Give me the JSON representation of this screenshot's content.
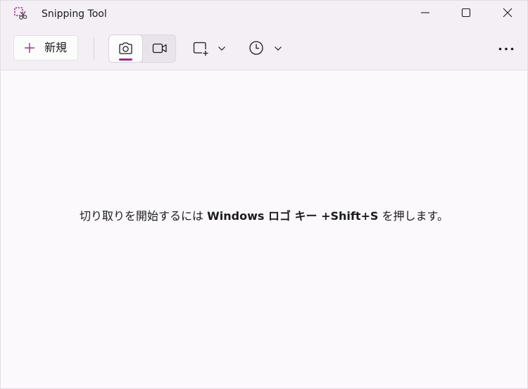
{
  "window": {
    "title": "Snipping Tool",
    "controls": {
      "minimize_icon": "minimize-icon",
      "maximize_icon": "maximize-icon",
      "close_icon": "close-icon"
    }
  },
  "toolbar": {
    "new_label": "新規",
    "new_icon": "plus-icon",
    "modes": [
      {
        "name": "snip-mode",
        "icon": "camera-icon",
        "selected": true
      },
      {
        "name": "record-mode",
        "icon": "video-camera-icon",
        "selected": false
      }
    ],
    "shape_icon": "rectangle-snip-icon",
    "delay_icon": "clock-icon",
    "more_icon": "more-options-icon"
  },
  "content": {
    "hint_prefix": "切り取りを開始するには ",
    "hint_key": "Windows ロゴ キー +Shift+S",
    "hint_suffix": " を押します。"
  },
  "colors": {
    "accent": "#9a2d84",
    "background": "#fbf9fc",
    "toolbar": "#f3eff5"
  }
}
